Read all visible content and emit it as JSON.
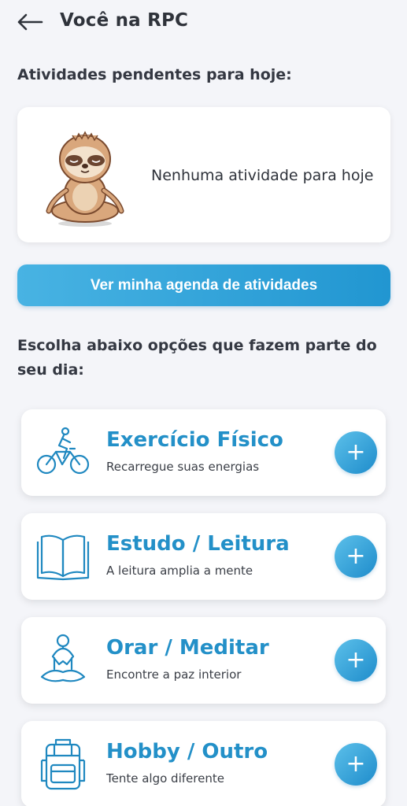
{
  "header": {
    "back_icon": "arrow-left-icon",
    "title": "Você na RPC"
  },
  "pending": {
    "title": "Atividades pendentes para hoje:",
    "empty_text": "Nenhuma atividade para hoje",
    "illustration": "meditating-sloth-illustration"
  },
  "agenda_button": {
    "label": "Ver minha agenda de atividades"
  },
  "choose": {
    "title": "Escolha abaixo opções que fazem parte do seu dia:"
  },
  "options": [
    {
      "title": "Exercício Físico",
      "subtitle": "Recarregue suas energias",
      "icon": "bicycle-icon",
      "action_icon": "plus-icon"
    },
    {
      "title": "Estudo / Leitura",
      "subtitle": "A leitura amplia a mente",
      "icon": "open-book-icon",
      "action_icon": "plus-icon"
    },
    {
      "title": "Orar / Meditar",
      "subtitle": "Encontre a paz interior",
      "icon": "meditation-icon",
      "action_icon": "plus-icon"
    },
    {
      "title": "Hobby / Outro",
      "subtitle": "Tente algo diferente",
      "icon": "backpack-icon",
      "action_icon": "plus-icon"
    }
  ],
  "colors": {
    "accent": "#2390c8",
    "button_gradient_start": "#48b3e3",
    "button_gradient_end": "#2196d1",
    "background": "#f4f5f9"
  }
}
